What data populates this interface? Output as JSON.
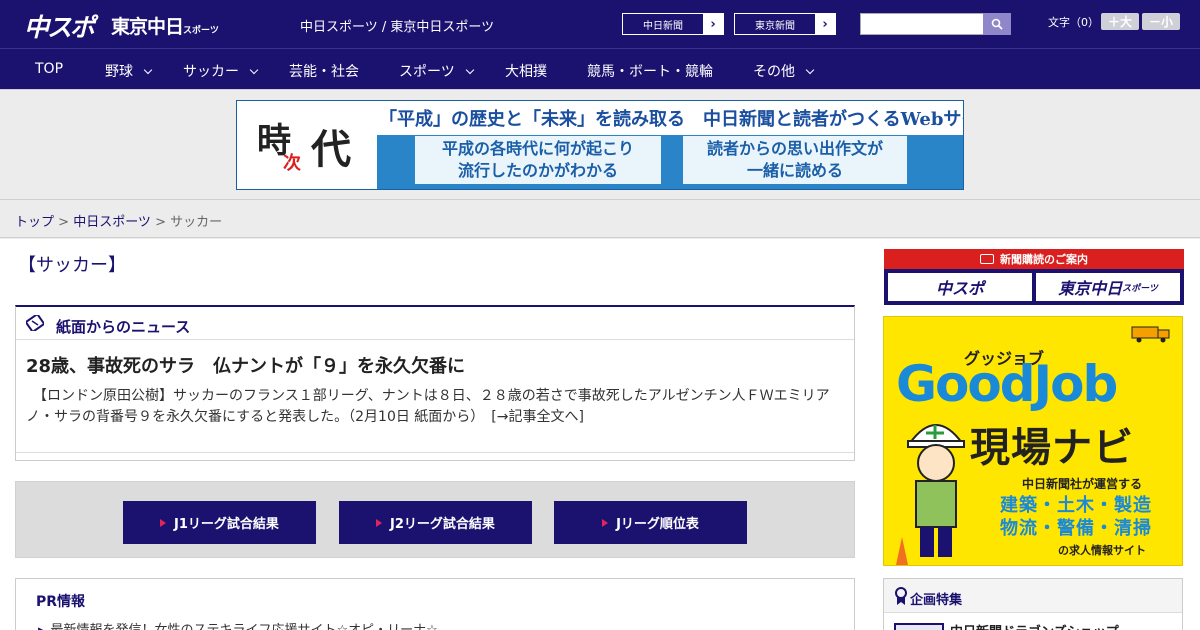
{
  "header": {
    "logo_chunichi": "中スポ",
    "logo_tokyo": "東京中日",
    "logo_tokyo_sub": "スポーツ",
    "site_links": "中日スポーツ / 東京中日スポーツ",
    "btn_chunichi": "中日新聞",
    "btn_tokyo": "東京新聞",
    "search_placeholder": "",
    "font_size_label": "文字（0）",
    "font_plus": "＋大",
    "font_minus": "－小"
  },
  "nav": {
    "items": [
      {
        "label": "TOP",
        "has_menu": false
      },
      {
        "label": "野球",
        "has_menu": true
      },
      {
        "label": "サッカー",
        "has_menu": true
      },
      {
        "label": "芸能・社会",
        "has_menu": false
      },
      {
        "label": "スポーツ",
        "has_menu": true
      },
      {
        "label": "大相撲",
        "has_menu": false
      },
      {
        "label": "競馬・ボート・競輪",
        "has_menu": false
      },
      {
        "label": "その他",
        "has_menu": true
      }
    ]
  },
  "banner": {
    "ji": "時",
    "tsugi": "次",
    "dai": "代",
    "headline": "「平成」の歴史と「未来」を読み取る　中日新聞と読者がつくるWebサイト",
    "box1_line1": "平成の各時代に何が起こり",
    "box1_line2": "流行したのかがわかる",
    "box2_line1": "読者からの思い出作文が",
    "box2_line2": "一緒に読める"
  },
  "breadcrumb": {
    "top": "トップ",
    "sep": " > ",
    "chunichi": "中日スポーツ",
    "current": "サッカー"
  },
  "main": {
    "category_title": "【サッカー】",
    "news_section_label": "紙面からのニュース",
    "news_title": "28歳、事故死のサラ　仏ナントが「９」を永久欠番に",
    "news_body": "　【ロンドン原田公樹】サッカーのフランス１部リーグ、ナントは８日、２８歳の若さで事故死したアルゼンチン人ＦＷエミリアノ・サラの背番号９を永久欠番にすると発表した。（2月10日 紙面から）　[→記事全文へ]",
    "buttons": [
      "J1リーグ試合結果",
      "J2リーグ試合結果",
      "Jリーグ順位表"
    ],
    "pr_title": "PR情報",
    "pr_item": "最新情報を発信！女性のステキライフ応援サイト☆オピ・リーナ☆"
  },
  "sidebar": {
    "subscribe_head": "新聞購読のご案内",
    "subscribe_chunichi": "中スポ",
    "subscribe_tokyo": "東京中日",
    "subscribe_tokyo_sub": "スポーツ",
    "gj_small": "グッジョブ",
    "gj_big": "GoodJob",
    "gj_navi": "現場ナビ",
    "gj_operator": "中日新聞社が運営する",
    "gj_list_line1": "建築・土木・製造",
    "gj_list_line2": "物流・警備・清掃",
    "gj_site": "の求人情報サイト",
    "feature_label": "企画特集",
    "feature_item": "中日新聞ドラゴンズショップ"
  },
  "colors": {
    "brand_navy": "#1b1270",
    "accent_red": "#d9201e",
    "goodjob_yellow": "#ffe600",
    "goodjob_blue": "#1a8ad8"
  }
}
